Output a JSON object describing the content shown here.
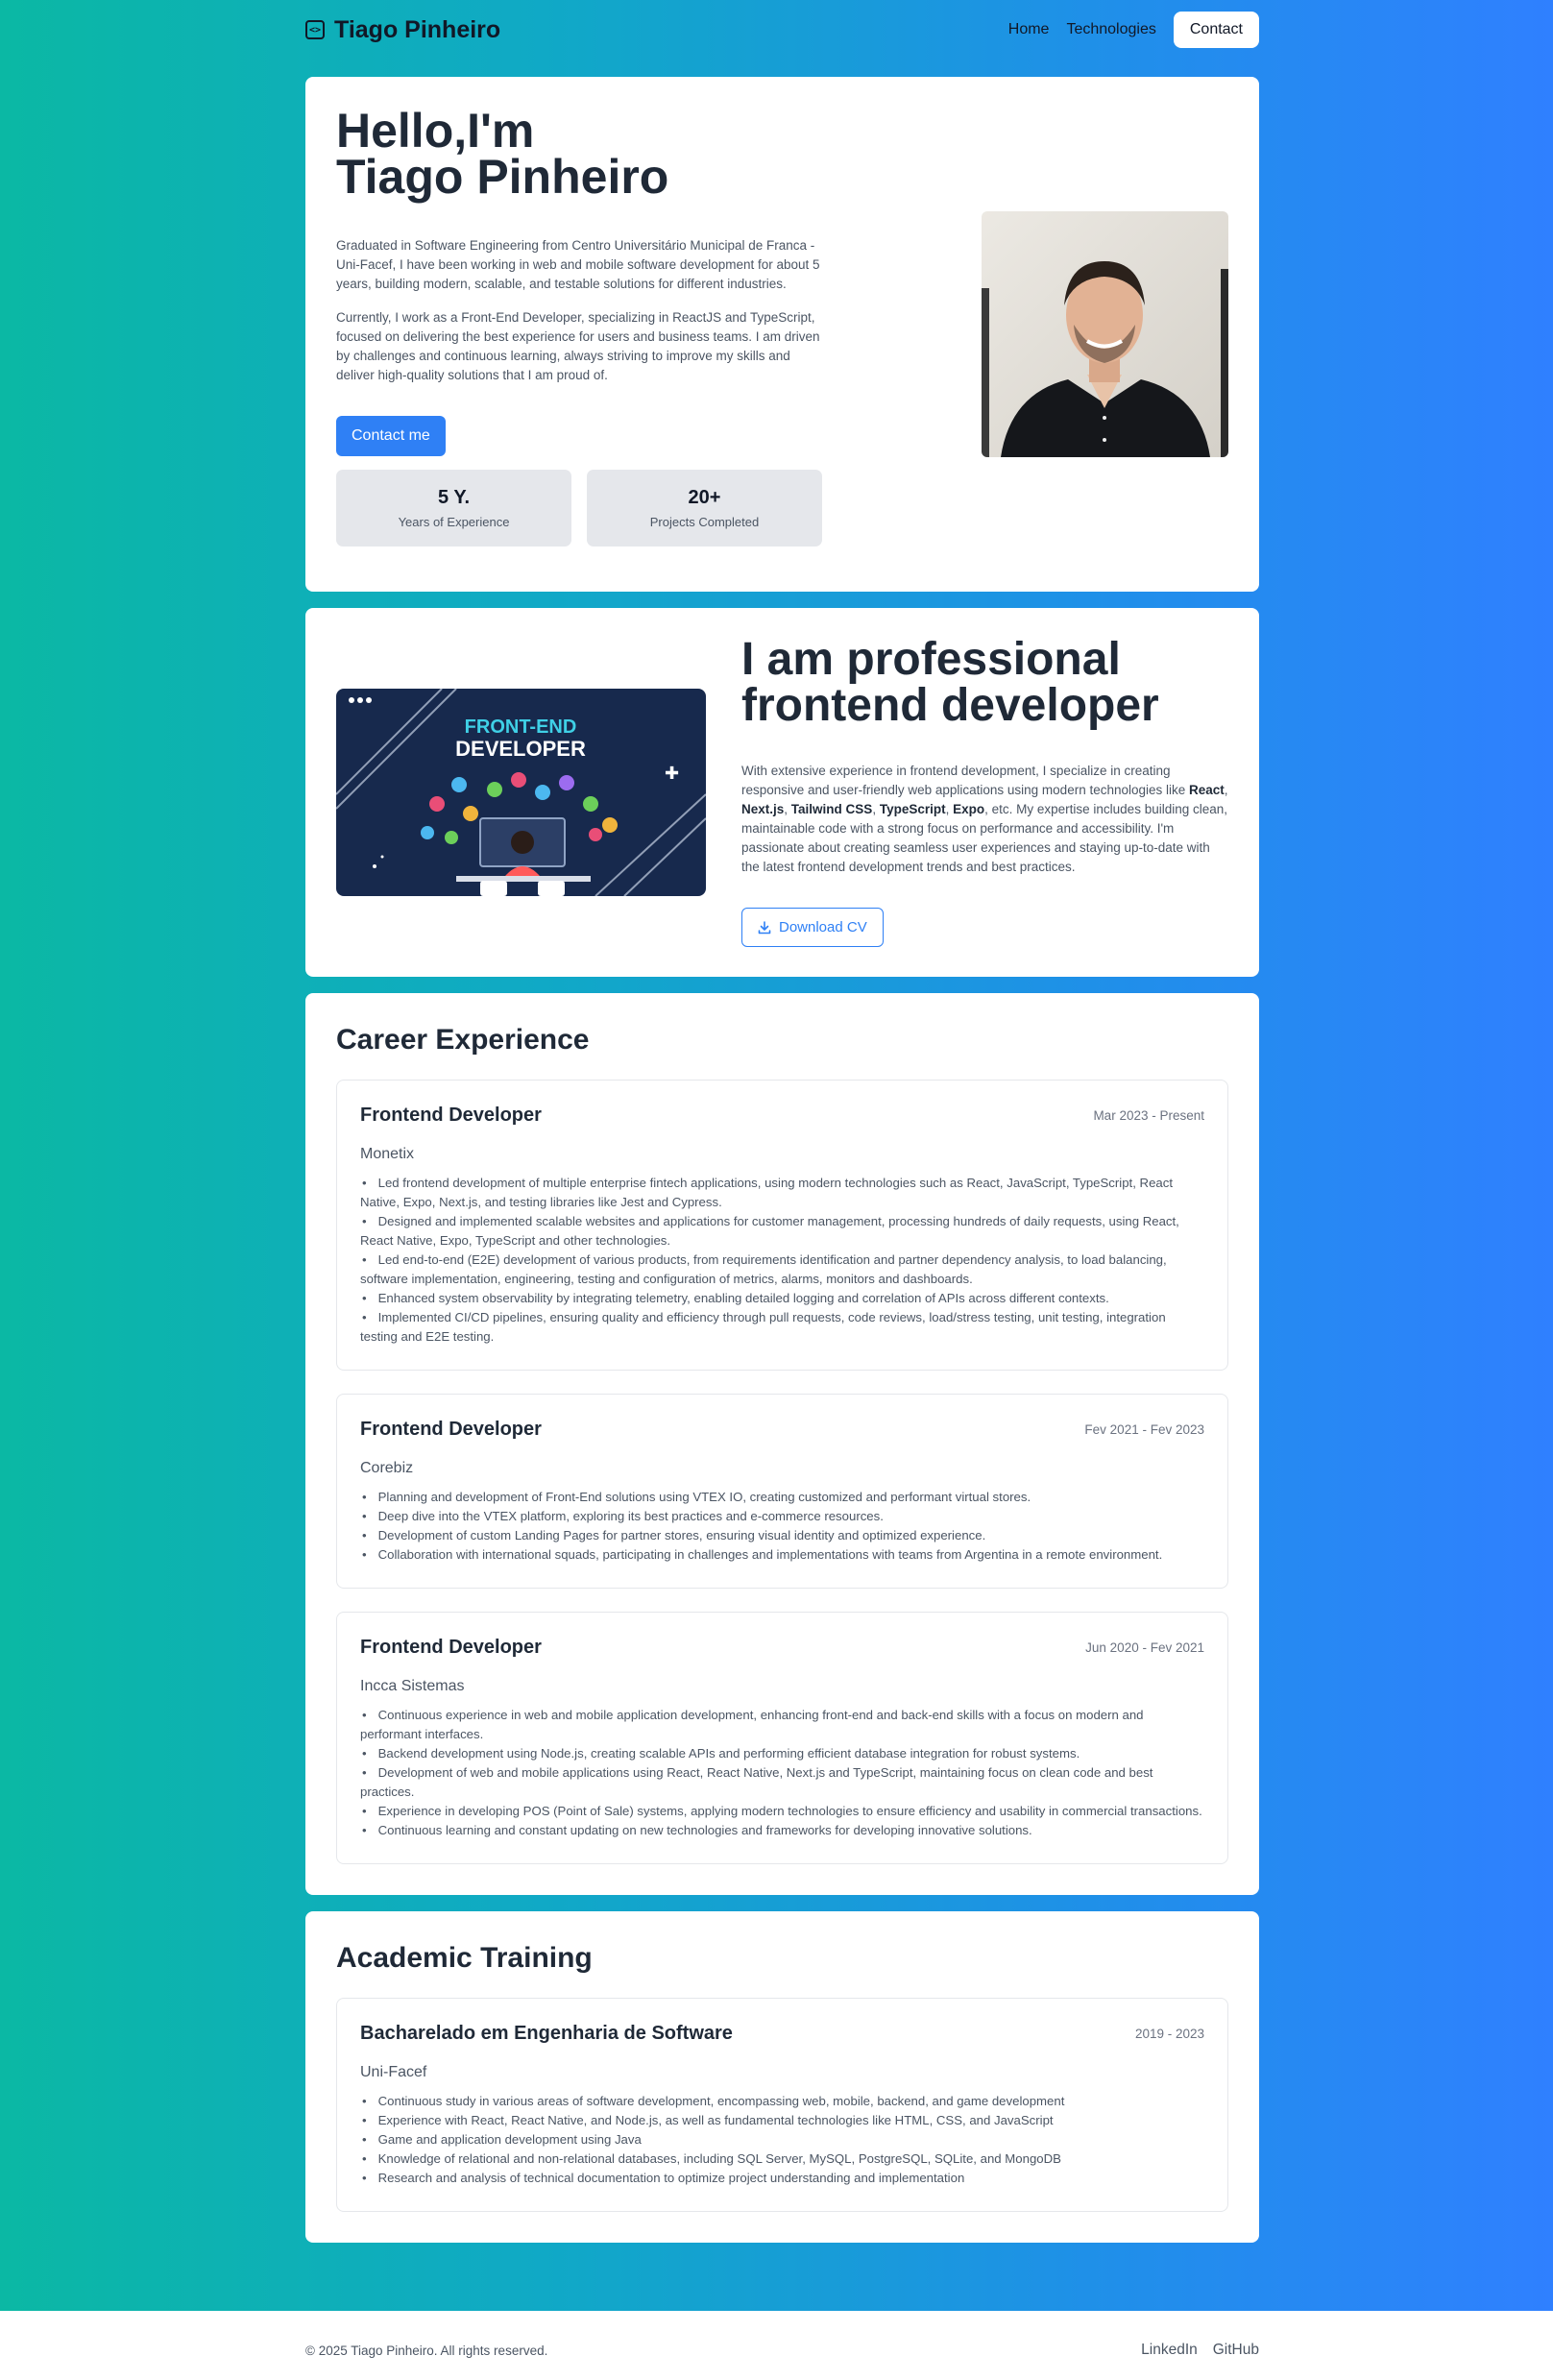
{
  "header": {
    "brand": "Tiago Pinheiro",
    "brand_icon": "code-icon",
    "nav": [
      "Home",
      "Technologies"
    ],
    "contact": "Contact"
  },
  "hero": {
    "title_line1": "Hello,I'm",
    "title_line2": "Tiago Pinheiro",
    "para1": "Graduated in Software Engineering from Centro Universitário Municipal de Franca - Uni-Facef, I have been working in web and mobile software development for about 5 years, building modern, scalable, and testable solutions for different industries.",
    "para2": "Currently, I work as a Front-End Developer, specializing in ReactJS and TypeScript, focused on delivering the best experience for users and business teams. I am driven by challenges and continuous learning, always striving to improve my skills and deliver high-quality solutions that I am proud of.",
    "cta": "Contact me",
    "stats": [
      {
        "value": "5 Y.",
        "label": "Years of Experience"
      },
      {
        "value": "20+",
        "label": "Projects Completed"
      }
    ]
  },
  "about": {
    "illustration_line1": "FRONT-END",
    "illustration_line2": "DEVELOPER",
    "title_line1": "I am professional",
    "title_line2": "frontend developer",
    "text_before": "With extensive experience in frontend development, I specialize in creating responsive and user-friendly web applications using modern technologies like ",
    "tech": [
      "React",
      "Next.js",
      "Tailwind CSS",
      "TypeScript",
      "Expo"
    ],
    "text_after": ", etc. My expertise includes building clean, maintainable code with a strong focus on performance and accessibility. I'm passionate about creating seamless user experiences and staying up-to-date with the latest frontend development trends and best practices.",
    "download": "Download CV"
  },
  "career": {
    "title": "Career Experience",
    "items": [
      {
        "role": "Frontend Developer",
        "date": "Mar 2023 - Present",
        "company": "Monetix",
        "bullets": [
          "Led frontend development of multiple enterprise fintech applications, using modern technologies such as React, JavaScript, TypeScript, React Native, Expo, Next.js, and testing libraries like Jest and Cypress.",
          "Designed and implemented scalable websites and applications for customer management, processing hundreds of daily requests, using React, React Native, Expo, TypeScript and other technologies.",
          "Led end-to-end (E2E) development of various products, from requirements identification and partner dependency analysis, to load balancing, software implementation, engineering, testing and configuration of metrics, alarms, monitors and dashboards.",
          "Enhanced system observability by integrating telemetry, enabling detailed logging and correlation of APIs across different contexts.",
          "Implemented CI/CD pipelines, ensuring quality and efficiency through pull requests, code reviews, load/stress testing, unit testing, integration testing and E2E testing."
        ]
      },
      {
        "role": "Frontend Developer",
        "date": "Fev 2021 - Fev 2023",
        "company": "Corebiz",
        "bullets": [
          "Planning and development of Front-End solutions using VTEX IO, creating customized and performant virtual stores.",
          "Deep dive into the VTEX platform, exploring its best practices and e-commerce resources.",
          "Development of custom Landing Pages for partner stores, ensuring visual identity and optimized experience.",
          "Collaboration with international squads, participating in challenges and implementations with teams from Argentina in a remote environment."
        ]
      },
      {
        "role": "Frontend Developer",
        "date": "Jun 2020 - Fev 2021",
        "company": "Incca Sistemas",
        "bullets": [
          "Continuous experience in web and mobile application development, enhancing front-end and back-end skills with a focus on modern and performant interfaces.",
          "Backend development using Node.js, creating scalable APIs and performing efficient database integration for robust systems.",
          "Development of web and mobile applications using React, React Native, Next.js and TypeScript, maintaining focus on clean code and best practices.",
          "Experience in developing POS (Point of Sale) systems, applying modern technologies to ensure efficiency and usability in commercial transactions.",
          "Continuous learning and constant updating on new technologies and frameworks for developing innovative solutions."
        ]
      }
    ]
  },
  "academic": {
    "title": "Academic Training",
    "items": [
      {
        "role": "Bacharelado em Engenharia de Software",
        "date": "2019 - 2023",
        "company": "Uni-Facef",
        "bullets": [
          "Continuous study in various areas of software development, encompassing web, mobile, backend, and game development",
          "Experience with React, React Native, and Node.js, as well as fundamental technologies like HTML, CSS, and JavaScript",
          "Game and application development using Java",
          "Knowledge of relational and non-relational databases, including SQL Server, MySQL, PostgreSQL, SQLite, and MongoDB",
          "Research and analysis of technical documentation to optimize project understanding and implementation"
        ]
      }
    ]
  },
  "footer": {
    "copyright": "© 2025 Tiago Pinheiro. All rights reserved.",
    "links": [
      "LinkedIn",
      "GitHub"
    ]
  }
}
